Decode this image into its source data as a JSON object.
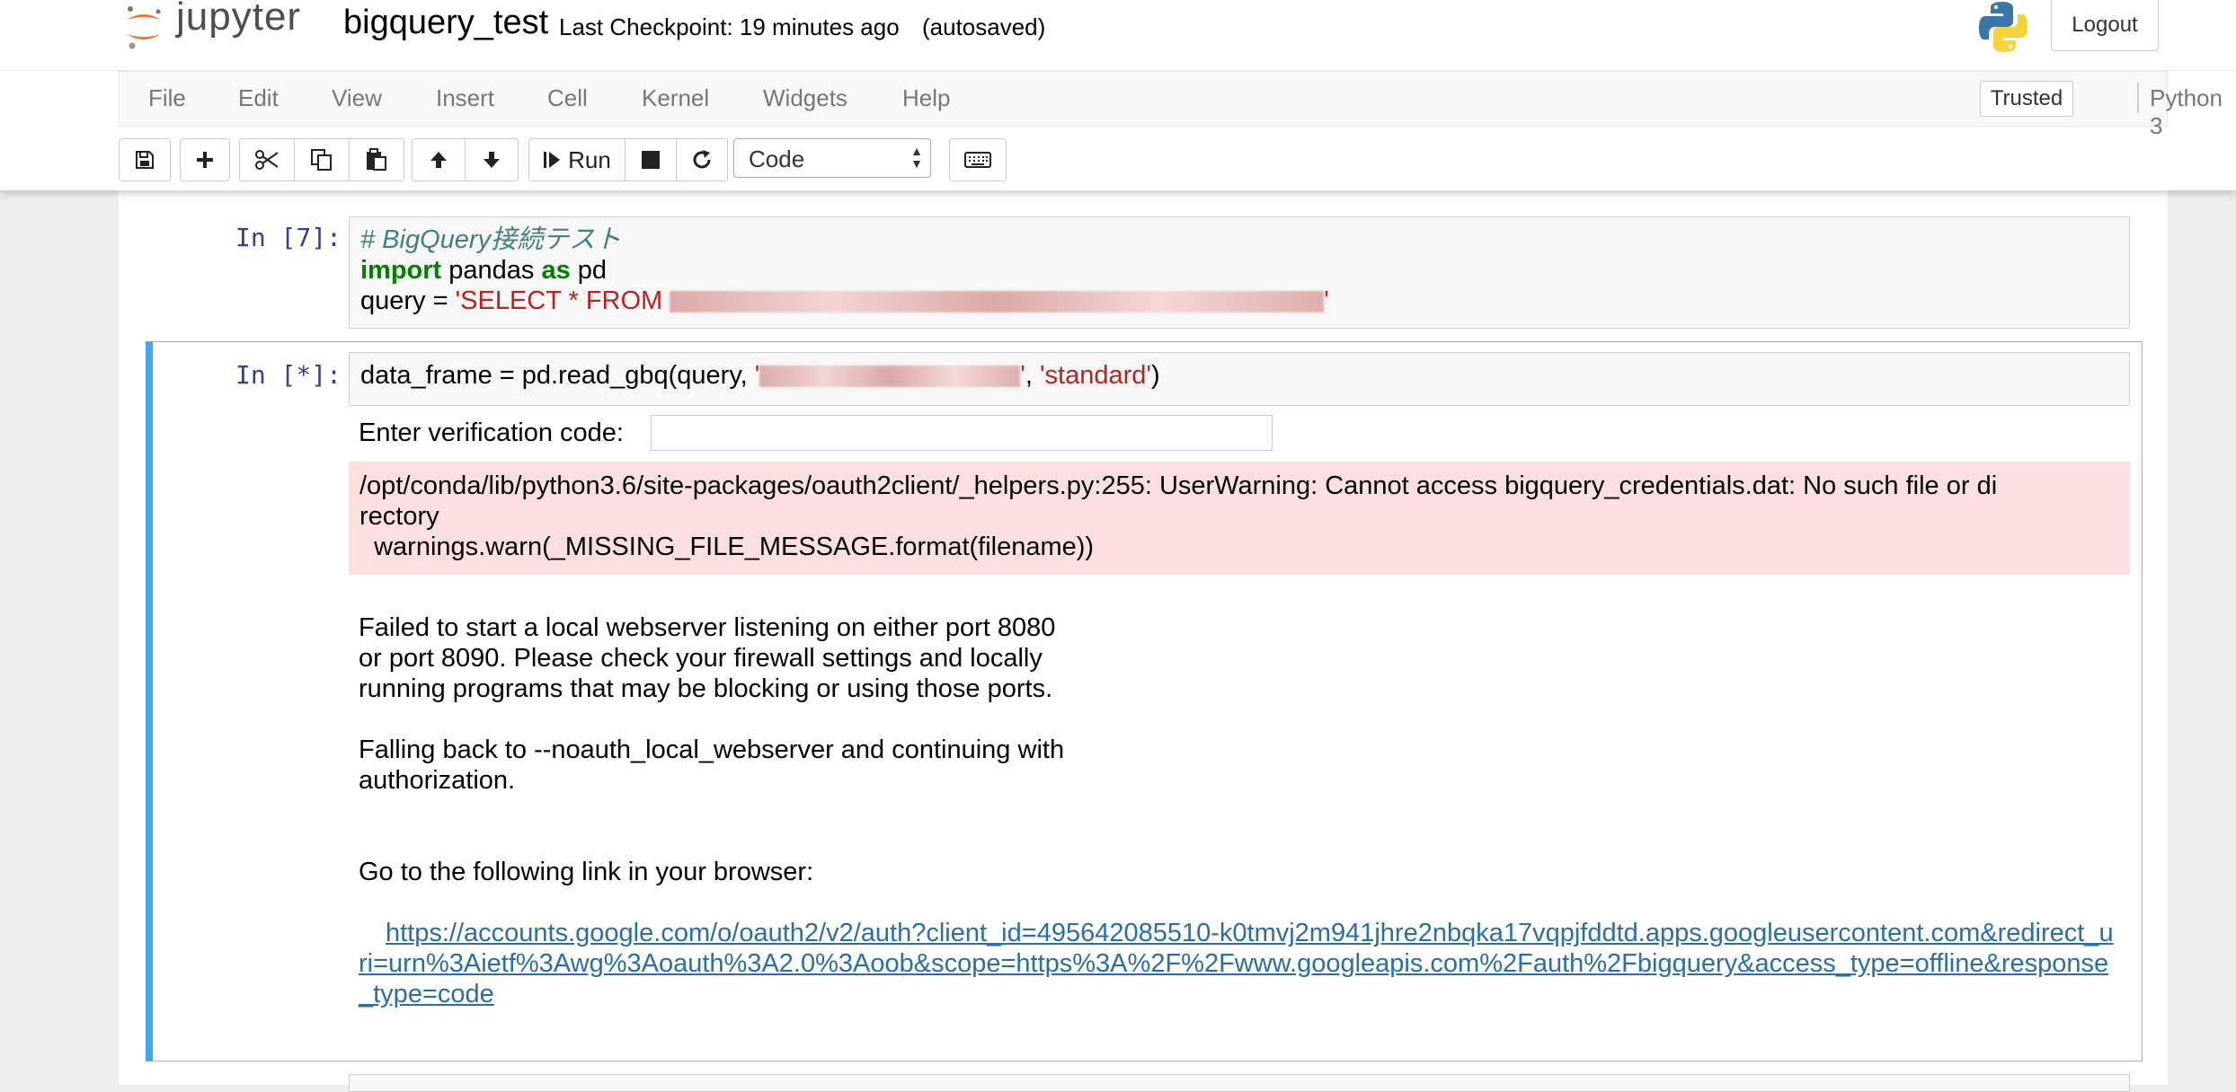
{
  "header": {
    "logo_text": "jupyter",
    "notebook_name": "bigquery_test",
    "checkpoint": "Last Checkpoint: 19 minutes ago",
    "autosave_status": "(autosaved)",
    "logout_label": "Logout"
  },
  "menubar": {
    "items": [
      "File",
      "Edit",
      "View",
      "Insert",
      "Cell",
      "Kernel",
      "Widgets",
      "Help"
    ],
    "trusted_label": "Trusted",
    "kernel_name": "Python 3"
  },
  "toolbar": {
    "buttons": [
      "save-icon",
      "plus-icon",
      "scissors-icon",
      "copy-icon",
      "paste-icon",
      "arrow-up-icon",
      "arrow-down-icon",
      "run-icon",
      "stop-icon",
      "restart-icon",
      "keyboard-icon"
    ],
    "run_label": "Run",
    "cell_type": "Code"
  },
  "cells": [
    {
      "prompt": "In [7]:",
      "code": {
        "comment": "# BigQuery接続テスト",
        "kw_import": "import",
        "module": " pandas ",
        "kw_as": "as",
        "alias": " pd",
        "query_prefix": "query = ",
        "query_string_start": "'SELECT * FROM ",
        "query_string_end": "'"
      }
    },
    {
      "prompt": "In [*]:",
      "code": {
        "prefix": "data_frame = pd.read_gbq(query, ",
        "arg1_quote_open": "'",
        "arg1_quote_close": "'",
        "sep": ", ",
        "arg2": "'standard'",
        "suffix": ")"
      },
      "outputs": {
        "verification_label": "Enter verification code:",
        "verification_value": "",
        "stderr_line1": "/opt/conda/lib/python3.6/site-packages/oauth2client/_helpers.py:255: UserWarning: Cannot access bigquery_credentials.dat: No such file or di",
        "stderr_line2": "rectory",
        "stderr_line3": "  warnings.warn(_MISSING_FILE_MESSAGE.format(filename))",
        "text_block1": "Failed to start a local webserver listening on either port 8080\nor port 8090. Please check your firewall settings and locally\nrunning programs that may be blocking or using those ports.\n\nFalling back to --noauth_local_webserver and continuing with\nauthorization.",
        "text_block2": "Go to the following link in your browser:",
        "link": "https://accounts.google.com/o/oauth2/v2/auth?client_id=495642085510-k0tmvj2m941jhre2nbqka17vqpjfddtd.apps.googleusercontent.com&redirect_uri=urn%3Aietf%3Awg%3Aoauth%3A2.0%3Aoob&scope=https%3A%2F%2Fwww.googleapis.com%2Fauth%2Fbigquery&access_type=offline&response_type=code"
      }
    }
  ],
  "colors": {
    "selected_cell_bar": "#42a5f5",
    "prompt": "#303f9f",
    "stderr_bg": "#fddfdf",
    "link": "#296eaa",
    "keyword": "#008000",
    "string": "#ba2121",
    "comment": "#408080"
  }
}
